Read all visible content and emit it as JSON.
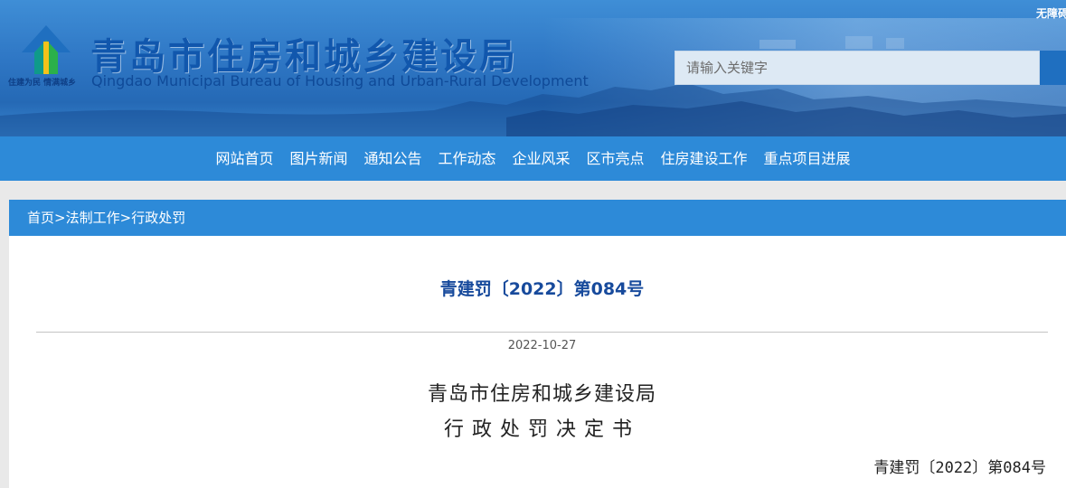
{
  "header": {
    "slogan": "住建为民 情满城乡",
    "title": "青岛市住房和城乡建设局",
    "subtitle": "Qingdao Municipal Bureau of Housing and Urban-Rural Development",
    "accessibility_label": "无障碍",
    "search_placeholder": "请输入关键字"
  },
  "nav": {
    "items": [
      {
        "label": "网站首页"
      },
      {
        "label": "图片新闻"
      },
      {
        "label": "通知公告"
      },
      {
        "label": "工作动态"
      },
      {
        "label": "企业风采"
      },
      {
        "label": "区市亮点"
      },
      {
        "label": "住房建设工作"
      },
      {
        "label": "重点项目进展"
      }
    ]
  },
  "breadcrumb": {
    "home": "首页",
    "sep1": ">",
    "level1": "法制工作",
    "sep2": ">",
    "level2": "行政处罚"
  },
  "article": {
    "doc_number": "青建罚〔2022〕第084号",
    "date": "2022-10-27",
    "title_line1": "青岛市住房和城乡建设局",
    "title_line2": "行政处罚决定书",
    "ref_number": "青建罚〔2022〕第084号"
  },
  "colors": {
    "banner": "#2e76c4",
    "nav": "#2d8ad8",
    "title_blue": "#1157ad",
    "doc_number": "#174a9c"
  }
}
